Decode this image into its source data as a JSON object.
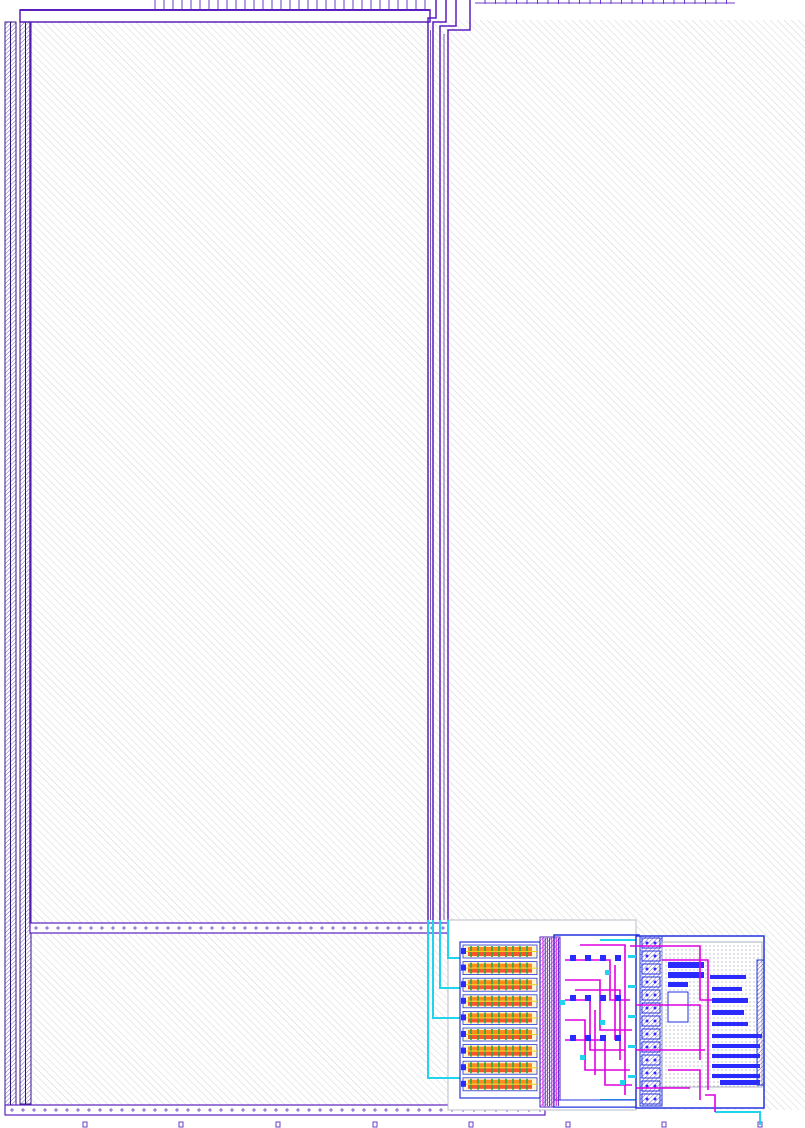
{
  "view": {
    "kind": "ic-layout-viewer",
    "background": "#ffffff"
  },
  "layers": {
    "hatch": "#c6c6c6",
    "metal_purple": "#5b1fbf",
    "metal_purple_dark": "#3a168a",
    "metal_blue": "#2233dd",
    "metal_blue_fill": "#2b2bff",
    "poly_magenta": "#e000e0",
    "via_cyan": "#22d3ee",
    "diff_orange": "#ff8c1a",
    "diff_red": "#ff2a00",
    "well_green": "#2aa84a",
    "well_yellow": "#e6d21a",
    "cell_outline": "#9aa0b4",
    "pin_mark": "#6a3dc9"
  },
  "blocks": [
    "left-power-rails",
    "top-bus",
    "vertical-routing-trunk",
    "bottom-rail",
    "transistor-array",
    "center-routing",
    "right-logic-block"
  ],
  "array": {
    "rows": 9
  }
}
